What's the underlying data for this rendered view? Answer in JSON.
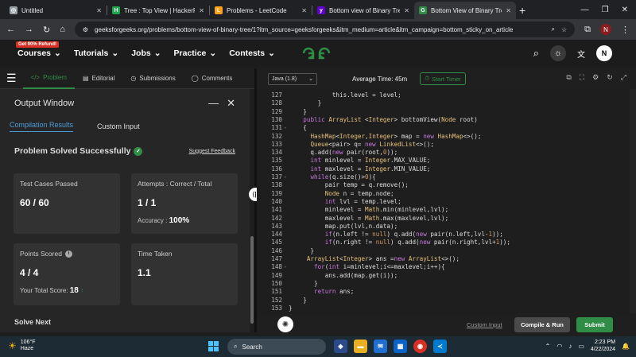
{
  "browser": {
    "tabs": [
      {
        "title": "Untitled",
        "icon": "globe-icon",
        "color": "#9aa0a6",
        "glyph": "◎",
        "active": false
      },
      {
        "title": "Tree : Top View | HackerRank",
        "icon": "hackerrank-icon",
        "color": "#1ba94c",
        "glyph": "H",
        "active": false
      },
      {
        "title": "Problems - LeetCode",
        "icon": "leetcode-icon",
        "color": "#ffa116",
        "glyph": "L",
        "active": false
      },
      {
        "title": "Bottom view of Binary Tree",
        "icon": "yahoo-icon",
        "color": "#6001d2",
        "glyph": "y",
        "active": false
      },
      {
        "title": "Bottom View of Binary Tree",
        "icon": "gfg-icon",
        "color": "#2f8d46",
        "glyph": "G",
        "active": true
      }
    ],
    "url": "geeksforgeeks.org/problems/bottom-view-of-binary-tree/1?itm_source=geeksforgeeks&itm_medium=article&itm_campaign=bottom_sticky_on_article",
    "profile_initial": "N"
  },
  "gfg_nav": {
    "refund_badge": "Get 90% Refund!",
    "items": [
      "Courses",
      "Tutorials",
      "Jobs",
      "Practice",
      "Contests"
    ],
    "logo": "GG",
    "user_initial": "N"
  },
  "problem_tabs": [
    {
      "label": "Problem",
      "icon": "code-icon",
      "glyph": "</>",
      "active": true
    },
    {
      "label": "Editorial",
      "icon": "document-icon",
      "glyph": "▤",
      "active": false
    },
    {
      "label": "Submissions",
      "icon": "history-icon",
      "glyph": "◷",
      "active": false
    },
    {
      "label": "Comments",
      "icon": "comment-icon",
      "glyph": "◯",
      "active": false
    }
  ],
  "output": {
    "title": "Output Window",
    "subtabs": [
      "Compilation Results",
      "Custom Input"
    ],
    "status": "Problem Solved Successfully",
    "feedback": "Suggest Feedback",
    "test_cases_label": "Test Cases Passed",
    "test_cases_value": "60 / 60",
    "attempts_label": "Attempts : Correct / Total",
    "attempts_value": "1 / 1",
    "accuracy_label": "Accuracy :",
    "accuracy_value": "100%",
    "points_label": "Points Scored",
    "points_value": "4 / 4",
    "total_score_label": "Your Total Score:",
    "total_score_value": "18",
    "time_label": "Time Taken",
    "time_value": "1.1",
    "solve_next": "Solve Next"
  },
  "editor_toolbar": {
    "language": "Java (1.8)",
    "avg_time": "Average Time: 45m",
    "timer_label": "Start Timer"
  },
  "code_lines": [
    {
      "n": "127",
      "fold": false,
      "text": "            this.level = level;"
    },
    {
      "n": "128",
      "fold": false,
      "text": "        }"
    },
    {
      "n": "129",
      "fold": false,
      "text": "    }"
    },
    {
      "n": "130",
      "fold": false,
      "text": "    public ArrayList <Integer> bottomView(Node root)"
    },
    {
      "n": "131",
      "fold": true,
      "text": "    {"
    },
    {
      "n": "132",
      "fold": false,
      "text": "      HashMap<Integer,Integer> map = new HashMap<>();"
    },
    {
      "n": "133",
      "fold": false,
      "text": "      Queue<pair> q= new LinkedList<>();"
    },
    {
      "n": "134",
      "fold": false,
      "text": "      q.add(new pair(root,0));"
    },
    {
      "n": "135",
      "fold": false,
      "text": "      int minlevel = Integer.MAX_VALUE;"
    },
    {
      "n": "136",
      "fold": false,
      "text": "      int maxlevel = Integer.MIN_VALUE;"
    },
    {
      "n": "137",
      "fold": true,
      "text": "      while(q.size()>0){"
    },
    {
      "n": "138",
      "fold": false,
      "text": "          pair temp = q.remove();"
    },
    {
      "n": "139",
      "fold": false,
      "text": "          Node n = temp.node;"
    },
    {
      "n": "140",
      "fold": false,
      "text": "          int lvl = temp.level;"
    },
    {
      "n": "141",
      "fold": false,
      "text": "          minlevel = Math.min(minlevel,lvl);"
    },
    {
      "n": "142",
      "fold": false,
      "text": "          maxlevel = Math.max(maxlevel,lvl);"
    },
    {
      "n": "143",
      "fold": false,
      "text": "          map.put(lvl,n.data);"
    },
    {
      "n": "144",
      "fold": false,
      "text": "          if(n.left != null) q.add(new pair(n.left,lvl-1));"
    },
    {
      "n": "145",
      "fold": false,
      "text": "          if(n.right != null) q.add(new pair(n.right,lvl+1));"
    },
    {
      "n": "146",
      "fold": false,
      "text": "      }"
    },
    {
      "n": "147",
      "fold": false,
      "text": "     ArrayList<Integer> ans =new ArrayList<>();"
    },
    {
      "n": "148",
      "fold": true,
      "text": "       for(int i=minlevel;i<=maxlevel;i++){"
    },
    {
      "n": "149",
      "fold": false,
      "text": "          ans.add(map.get(i));"
    },
    {
      "n": "150",
      "fold": false,
      "text": "       }"
    },
    {
      "n": "151",
      "fold": false,
      "text": "       return ans;"
    },
    {
      "n": "152",
      "fold": false,
      "text": "    }"
    },
    {
      "n": "153",
      "fold": false,
      "text": "}"
    }
  ],
  "bottom_actions": {
    "custom_input": "Custom Input",
    "compile": "Compile & Run",
    "submit": "Submit"
  },
  "taskbar": {
    "temp": "106°F",
    "condition": "Haze",
    "search": "Search",
    "time": "2:23 PM",
    "date": "4/22/2024"
  },
  "colors": {
    "accent": "#2f8d46",
    "link": "#4a9ed8"
  }
}
